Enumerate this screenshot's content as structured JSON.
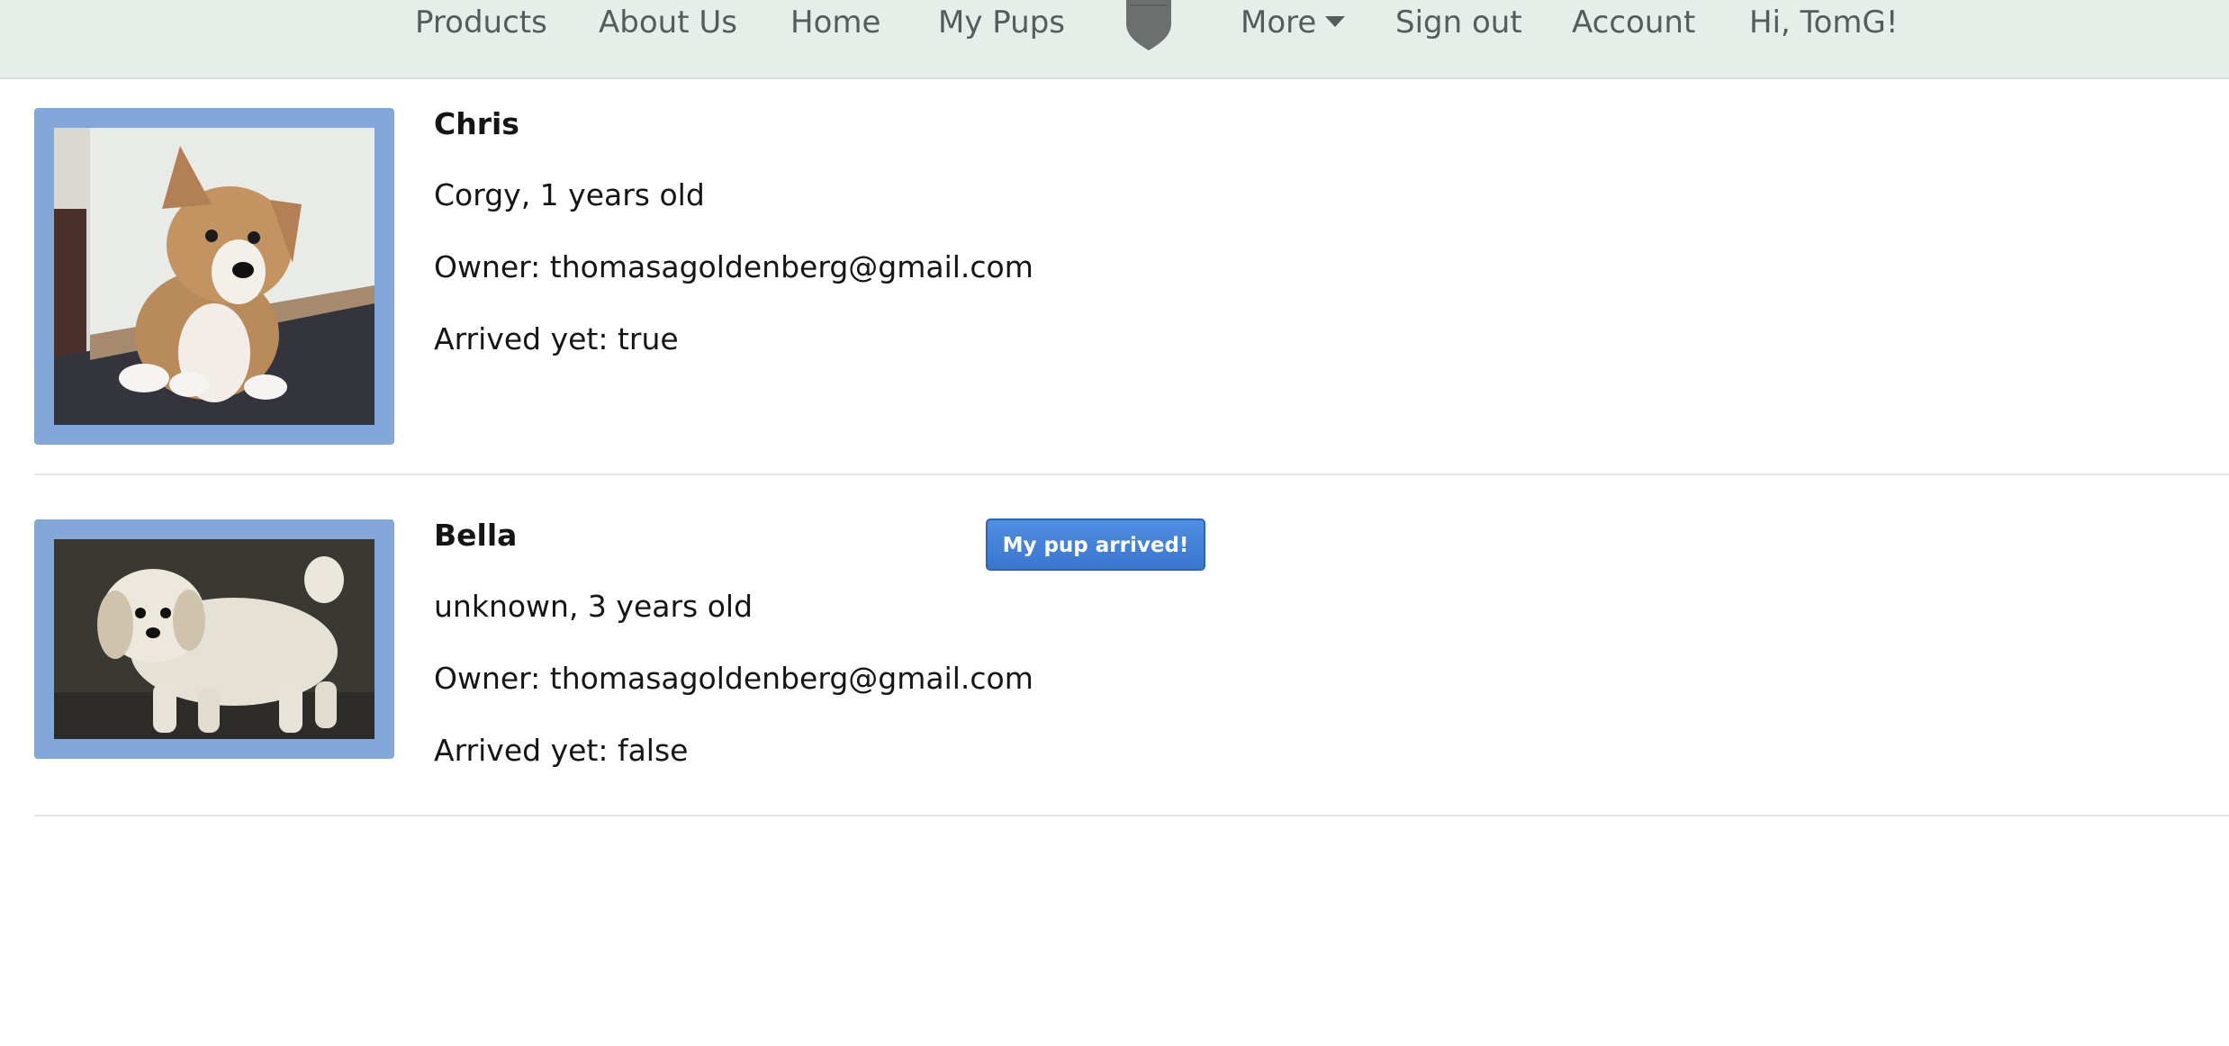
{
  "nav": {
    "items": [
      {
        "label": "Products"
      },
      {
        "label": "About Us"
      },
      {
        "label": "Home"
      },
      {
        "label": "My Pups"
      },
      {
        "label": "More"
      },
      {
        "label": "Sign out"
      },
      {
        "label": "Account"
      },
      {
        "label": "Hi, TomG!"
      }
    ],
    "logo_icon": "badge-logo-icon",
    "more_icon": "chevron-down-icon",
    "background": "#e6eeea",
    "text_color": "#555c5a"
  },
  "pups": [
    {
      "name": "Chris",
      "breed_age": "Corgy, 1 years old",
      "owner": "Owner: thomasagoldenberg@gmail.com",
      "arrived": "Arrived yet: true",
      "photo_icon": "corgi-puppy-photo"
    },
    {
      "name": "Bella",
      "breed_age": "unknown, 3 years old",
      "owner": "Owner: thomasagoldenberg@gmail.com",
      "arrived": "Arrived yet: false",
      "photo_icon": "white-terrier-photo",
      "action_label": "My pup arrived!"
    }
  ],
  "colors": {
    "frame": "#84a7da",
    "button": "#3f7fd6"
  }
}
